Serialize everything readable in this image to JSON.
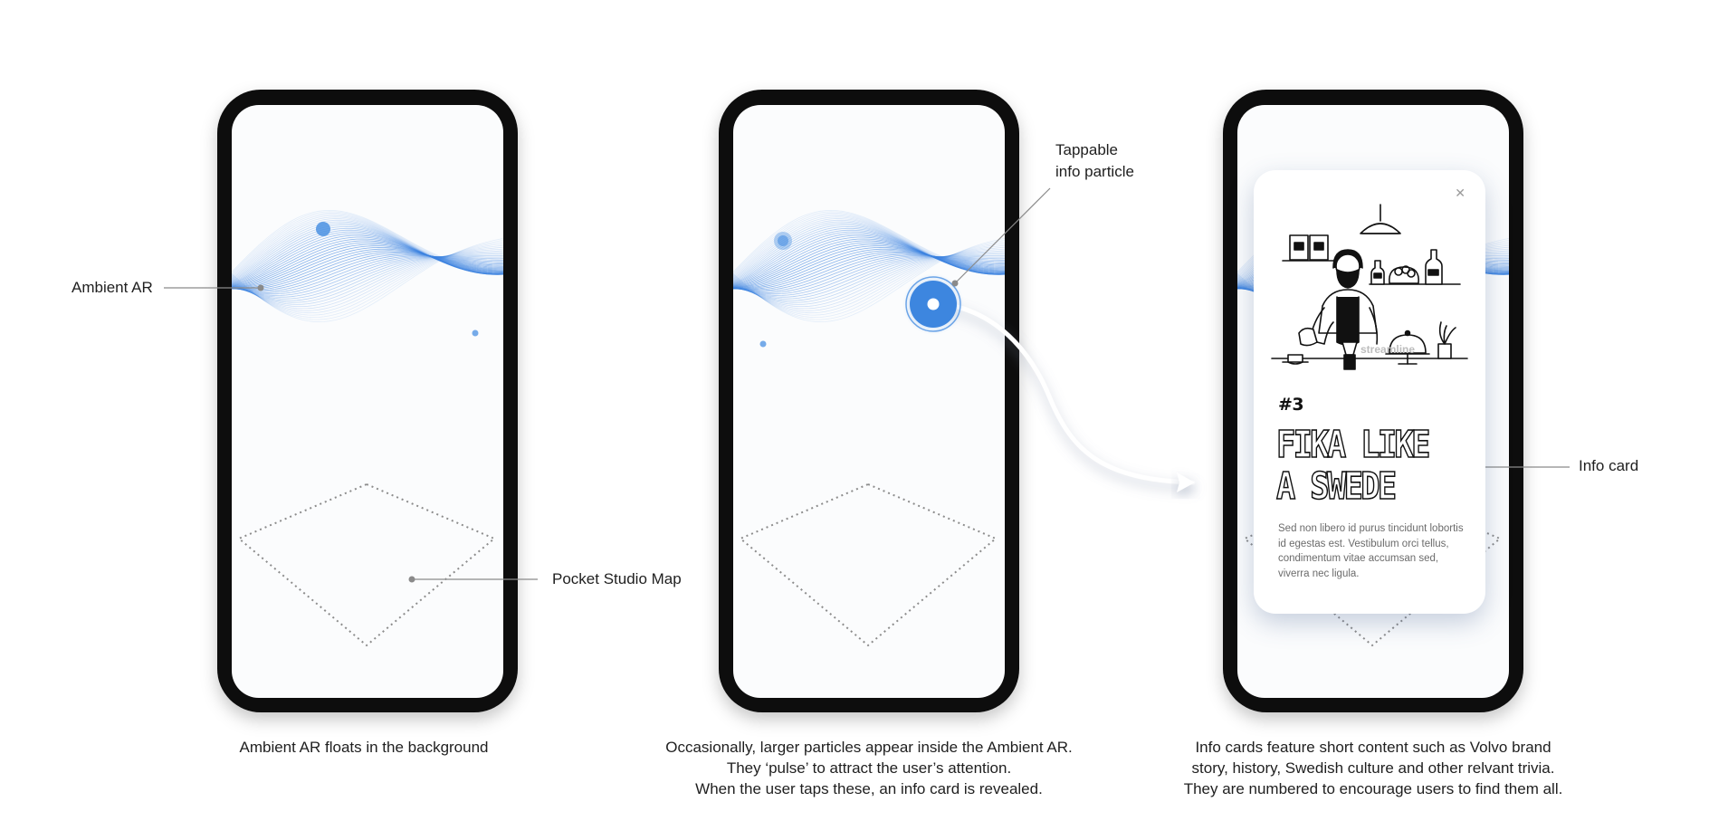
{
  "colors": {
    "phone_frame": "#0d0d0d",
    "screen_bg": "#fbfcfd",
    "wave_blue": "#3b82e0",
    "particle_blue": "#4a90e2",
    "leader_gray": "#8a8a8a",
    "map_dots": "#8c8c8c"
  },
  "panels": [
    {
      "callouts": [
        "Ambient AR",
        "Pocket Studio Map"
      ],
      "caption": [
        "Ambient AR floats in the background"
      ]
    },
    {
      "callouts": [
        "Tappable",
        "info particle"
      ],
      "caption": [
        "Occasionally, larger particles appear inside the Ambient AR.",
        "They ‘pulse’ to attract the user’s attention.",
        "When the user taps these, an info card is revealed."
      ]
    },
    {
      "callouts": [
        "Info card"
      ],
      "caption": [
        "Info cards feature short content such as Volvo brand",
        "story, history, Swedish culture and other relvant trivia.",
        "They are numbered to encourage users to find them all."
      ]
    }
  ],
  "info_card": {
    "close_icon": "close-icon",
    "number": "#3",
    "title_line1": "FIKA LIKE",
    "title_line2": "A SWEDE",
    "body": "Sed non libero id purus tincidunt lobortis id egestas est. Vestibulum orci tellus, condimentum vitae accumsan sed, viverra nec ligula.",
    "illustration": "barista-illustration",
    "illustration_watermark": "streamline"
  }
}
